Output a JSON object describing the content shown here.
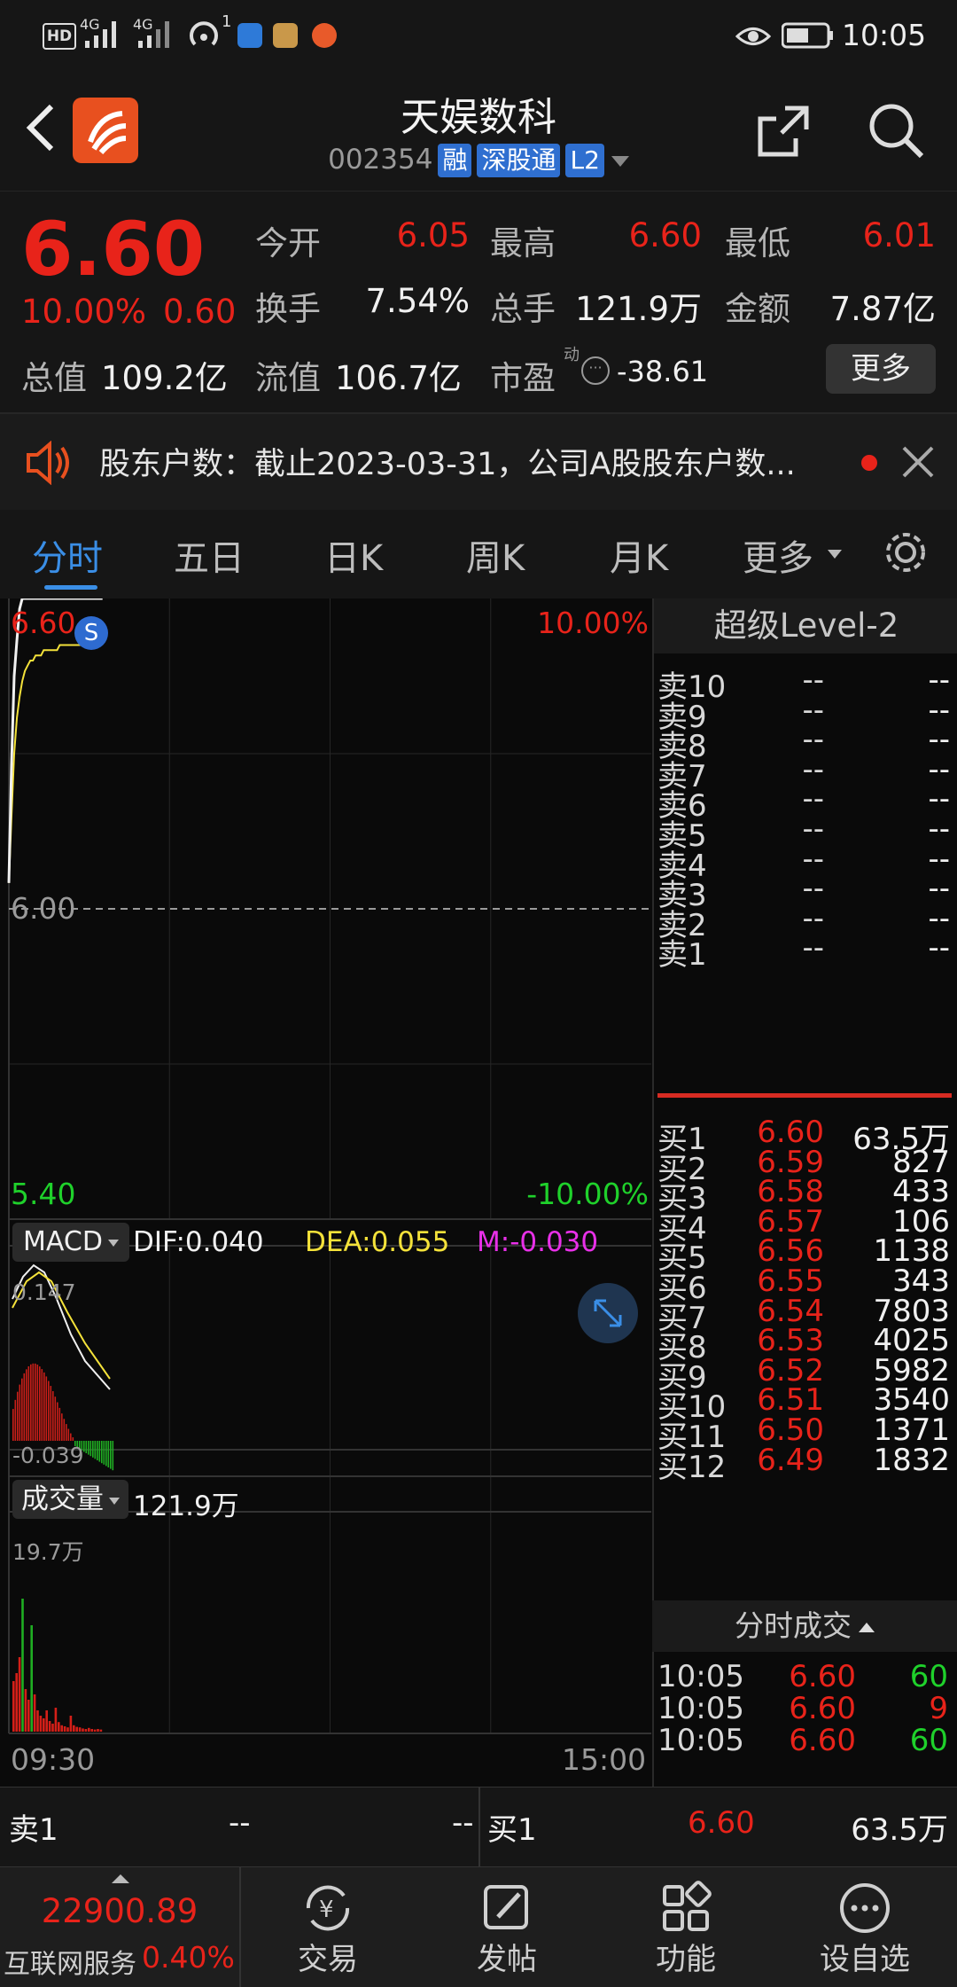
{
  "status_bar": {
    "left_icons": [
      "hd-icon",
      "signal-4g-icon",
      "signal-4g-icon",
      "hotspot-icon",
      "shield-app-icon",
      "wallet-app-icon",
      "eastmoney-app-icon"
    ],
    "network1": "4G",
    "network2": "4G",
    "hotspot_count": "1",
    "time": "10:05"
  },
  "header": {
    "title": "天娱数科",
    "code": "002354",
    "tags": [
      "融",
      "深股通",
      "L2"
    ]
  },
  "quote": {
    "price": "6.60",
    "change_pct": "10.00%",
    "change": "0.60",
    "open_label": "今开",
    "open": "6.05",
    "high_label": "最高",
    "high": "6.60",
    "low_label": "最低",
    "low": "6.01",
    "turnover_label": "换手",
    "turnover": "7.54%",
    "volume_label": "总手",
    "volume": "121.9万",
    "amount_label": "金额",
    "amount": "7.87亿",
    "mcap_label": "总值",
    "mcap": "109.2亿",
    "float_label": "流值",
    "float": "106.7亿",
    "pe_label": "市盈",
    "pe_sup": "动",
    "pe": "-38.61",
    "more_label": "更多"
  },
  "notice": {
    "text": "股东户数：截止2023-03-31，公司A股股东户数..."
  },
  "tabs": [
    "分时",
    "五日",
    "日K",
    "周K",
    "月K",
    "更多"
  ],
  "chart": {
    "price_top": "6.60",
    "pct_top": "10.00%",
    "price_mid": "6.00",
    "price_bottom": "5.40",
    "pct_bottom": "-10.00%",
    "marker": "S",
    "macd_label": "MACD",
    "dif": "DIF:0.040",
    "dea": "DEA:0.055",
    "m": "M:-0.030",
    "macd_top": "0.147",
    "macd_bottom": "-0.039",
    "vol_label": "成交量",
    "vol_total": "121.9万",
    "vol_max": "19.7万",
    "time_start": "09:30",
    "time_end": "15:00"
  },
  "chart_data": {
    "type": "line",
    "title": "",
    "x": [
      "09:30",
      "09:31",
      "09:32",
      "09:33",
      "09:34",
      "09:35",
      "09:36",
      "09:37",
      "09:38",
      "09:39",
      "09:40",
      "09:41",
      "09:42",
      "09:43",
      "09:44",
      "09:45",
      "09:46",
      "09:47",
      "09:48",
      "09:49",
      "09:50",
      "09:51",
      "09:52",
      "09:53",
      "09:54",
      "09:55",
      "09:56",
      "09:57",
      "09:58",
      "09:59",
      "10:00",
      "10:01",
      "10:02",
      "10:03",
      "10:04",
      "10:05"
    ],
    "series": [
      {
        "name": "price",
        "color": "#f0f0f0",
        "values": [
          6.05,
          6.28,
          6.45,
          6.52,
          6.58,
          6.6,
          6.6,
          6.6,
          6.6,
          6.6,
          6.6,
          6.6,
          6.6,
          6.6,
          6.6,
          6.6,
          6.6,
          6.6,
          6.6,
          6.6,
          6.6,
          6.6,
          6.6,
          6.6,
          6.6,
          6.6,
          6.6,
          6.6,
          6.6,
          6.6,
          6.6,
          6.6,
          6.6,
          6.6,
          6.6,
          6.6
        ]
      },
      {
        "name": "avg",
        "color": "#f4e23a",
        "values": [
          6.05,
          6.18,
          6.3,
          6.37,
          6.41,
          6.44,
          6.46,
          6.47,
          6.48,
          6.48,
          6.49,
          6.49,
          6.49,
          6.5,
          6.5,
          6.5,
          6.5,
          6.5,
          6.5,
          6.51,
          6.51,
          6.51,
          6.51,
          6.51,
          6.51,
          6.51,
          6.51,
          6.51,
          6.51,
          6.51,
          6.52,
          6.52,
          6.52,
          6.52,
          6.52,
          6.52
        ]
      }
    ],
    "ylim": [
      5.4,
      6.6
    ],
    "xlim": [
      "09:30",
      "15:00"
    ],
    "grid": true
  },
  "orderbook": {
    "title": "超级Level-2",
    "sells": [
      {
        "label": "卖10",
        "price": "--",
        "vol": "--"
      },
      {
        "label": "卖9",
        "price": "--",
        "vol": "--"
      },
      {
        "label": "卖8",
        "price": "--",
        "vol": "--"
      },
      {
        "label": "卖7",
        "price": "--",
        "vol": "--"
      },
      {
        "label": "卖6",
        "price": "--",
        "vol": "--"
      },
      {
        "label": "卖5",
        "price": "--",
        "vol": "--"
      },
      {
        "label": "卖4",
        "price": "--",
        "vol": "--"
      },
      {
        "label": "卖3",
        "price": "--",
        "vol": "--"
      },
      {
        "label": "卖2",
        "price": "--",
        "vol": "--"
      },
      {
        "label": "卖1",
        "price": "--",
        "vol": "--"
      }
    ],
    "buys": [
      {
        "label": "买1",
        "price": "6.60",
        "vol": "63.5万"
      },
      {
        "label": "买2",
        "price": "6.59",
        "vol": "827"
      },
      {
        "label": "买3",
        "price": "6.58",
        "vol": "433"
      },
      {
        "label": "买4",
        "price": "6.57",
        "vol": "106"
      },
      {
        "label": "买5",
        "price": "6.56",
        "vol": "1138"
      },
      {
        "label": "买6",
        "price": "6.55",
        "vol": "343"
      },
      {
        "label": "买7",
        "price": "6.54",
        "vol": "7803"
      },
      {
        "label": "买8",
        "price": "6.53",
        "vol": "4025"
      },
      {
        "label": "买9",
        "price": "6.52",
        "vol": "5982"
      },
      {
        "label": "买10",
        "price": "6.51",
        "vol": "3540"
      },
      {
        "label": "买11",
        "price": "6.50",
        "vol": "1371"
      },
      {
        "label": "买12",
        "price": "6.49",
        "vol": "1832"
      }
    ],
    "ticks_title": "分时成交",
    "ticks": [
      {
        "time": "10:05",
        "price": "6.60",
        "vol": "60"
      },
      {
        "time": "10:05",
        "price": "6.60",
        "vol": "9"
      },
      {
        "time": "10:05",
        "price": "6.60",
        "vol": "60"
      }
    ]
  },
  "bottom_ob": {
    "sell_label": "卖1",
    "sell_price": "--",
    "sell_vol": "--",
    "buy_label": "买1",
    "buy_price": "6.60",
    "buy_vol": "63.5万"
  },
  "nav": {
    "index_value": "22900.89",
    "index_name": "互联网服务",
    "index_change": "0.40%",
    "items": [
      "交易",
      "发帖",
      "功能",
      "设自选"
    ]
  },
  "colors": {
    "up": "#e8231a",
    "down": "#1fd12b",
    "accent": "#3a8ee6",
    "avg_line": "#f4e23a"
  }
}
